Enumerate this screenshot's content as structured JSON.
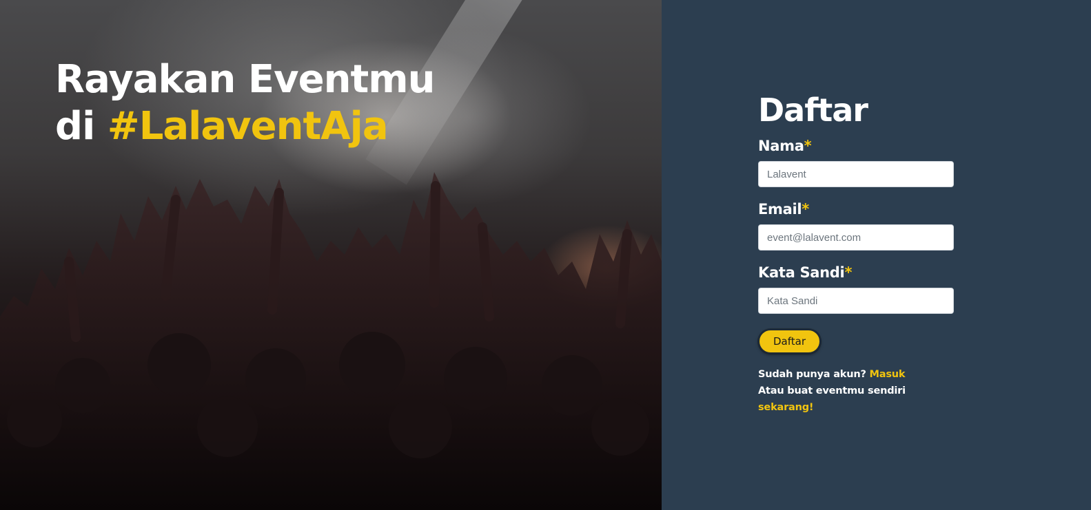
{
  "hero": {
    "title_line1": "Rayakan Eventmu",
    "title_line2_prefix": "di ",
    "title_line2_highlight": "#LalaventAja"
  },
  "form": {
    "title": "Daftar",
    "required_mark": "*",
    "fields": [
      {
        "label": "Nama",
        "placeholder": "Lalavent"
      },
      {
        "label": "Email",
        "placeholder": "event@lalavent.com"
      },
      {
        "label": "Kata Sandi",
        "placeholder": "Kata Sandi"
      }
    ],
    "submit_label": "Daftar",
    "login_prompt": "Sudah punya akun? ",
    "login_link": "Masuk",
    "create_prompt": "Atau buat eventmu sendiri ",
    "create_link": "sekarang!"
  },
  "colors": {
    "accent": "#f1c40f",
    "panel_bg": "#2c3e50"
  }
}
